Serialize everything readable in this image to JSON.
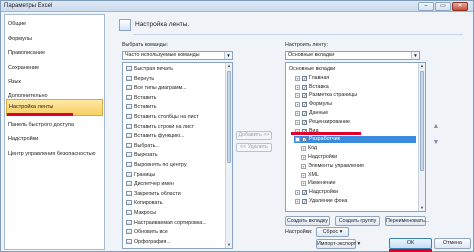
{
  "window": {
    "title": "Параметры Excel",
    "minimize": "–",
    "maximize": "▭",
    "close": "✕"
  },
  "sidebar": {
    "items": [
      "Общие",
      "Формулы",
      "Правописание",
      "Сохранение",
      "Язык",
      "Дополнительно",
      "Настройка ленты",
      "Панель быстрого доступа",
      "Надстройки",
      "Центр управления безопасностью"
    ],
    "active_index": 6
  },
  "main": {
    "heading": "Настройка ленты.",
    "left_label": "Выбрать команды:",
    "left_combo_value": "Часто используемые команды",
    "commands": [
      {
        "label": "Быстрая печать",
        "icon": "quick-print-icon"
      },
      {
        "label": "Вернуть",
        "icon": "redo-icon"
      },
      {
        "label": "Все типы диаграмм...",
        "icon": "chart-icon"
      },
      {
        "label": "Вставить",
        "icon": "paste-icon"
      },
      {
        "label": "Вставить",
        "icon": "insert-icon"
      },
      {
        "label": "Вставить столбцы на лист",
        "icon": "insert-columns-icon"
      },
      {
        "label": "Вставить строки на лист",
        "icon": "insert-rows-icon"
      },
      {
        "label": "Вставить функцию...",
        "icon": "function-icon"
      },
      {
        "label": "Выбрать...",
        "icon": "select-icon"
      },
      {
        "label": "Вырезать",
        "icon": "scissors-icon"
      },
      {
        "label": "Выровнять по центру",
        "icon": "align-center-icon"
      },
      {
        "label": "Границы",
        "icon": "borders-icon"
      },
      {
        "label": "Диспетчер имен",
        "icon": "name-manager-icon"
      },
      {
        "label": "Закрепить области",
        "icon": "freeze-panes-icon"
      },
      {
        "label": "Копировать",
        "icon": "copy-icon"
      },
      {
        "label": "Макросы",
        "icon": "macros-icon"
      },
      {
        "label": "Настраиваемая сортировка...",
        "icon": "sort-icon"
      },
      {
        "label": "Обновить все",
        "icon": "refresh-icon"
      },
      {
        "label": "Орфография...",
        "icon": "spelling-icon"
      }
    ],
    "add_button": "Добавить >>",
    "remove_button": "<< Удалить",
    "right_label": "Настроить ленту:",
    "right_combo_value": "Основные вкладки",
    "tree": [
      {
        "label": "Основные вкладки",
        "level": 0,
        "expander": "",
        "checkbox": false
      },
      {
        "label": "Главная",
        "level": 1,
        "expander": "+",
        "checkbox": true
      },
      {
        "label": "Вставка",
        "level": 1,
        "expander": "+",
        "checkbox": true
      },
      {
        "label": "Разметка страницы",
        "level": 1,
        "expander": "+",
        "checkbox": true
      },
      {
        "label": "Формулы",
        "level": 1,
        "expander": "+",
        "checkbox": true
      },
      {
        "label": "Данные",
        "level": 1,
        "expander": "+",
        "checkbox": true
      },
      {
        "label": "Рецензирование",
        "level": 1,
        "expander": "+",
        "checkbox": true
      },
      {
        "label": "Вид",
        "level": 1,
        "expander": "+",
        "checkbox": true
      },
      {
        "label": "Разработчик",
        "level": 1,
        "expander": "−",
        "checkbox": true,
        "selected": true
      },
      {
        "label": "Код",
        "level": 2,
        "expander": "+",
        "checkbox": false
      },
      {
        "label": "Надстройки",
        "level": 2,
        "expander": "+",
        "checkbox": false
      },
      {
        "label": "Элементы управления",
        "level": 2,
        "expander": "+",
        "checkbox": false
      },
      {
        "label": "XML",
        "level": 2,
        "expander": "+",
        "checkbox": false
      },
      {
        "label": "Изменение",
        "level": 2,
        "expander": "+",
        "checkbox": false
      },
      {
        "label": "Надстройки",
        "level": 1,
        "expander": "+",
        "checkbox": true
      },
      {
        "label": "Удаление фона",
        "level": 1,
        "expander": "+",
        "checkbox": true
      }
    ],
    "new_tab_button": "Создать вкладку",
    "new_group_button": "Создать группу",
    "rename_button": "Переименовать...",
    "settings_label": "Настройки:",
    "reset_button": "Сброс ▾",
    "import_export_button": "Импорт-экспорт ▾",
    "up_arrow": "▲",
    "down_arrow": "▼"
  },
  "footer": {
    "ok": "ОК",
    "cancel": "Отмена"
  }
}
